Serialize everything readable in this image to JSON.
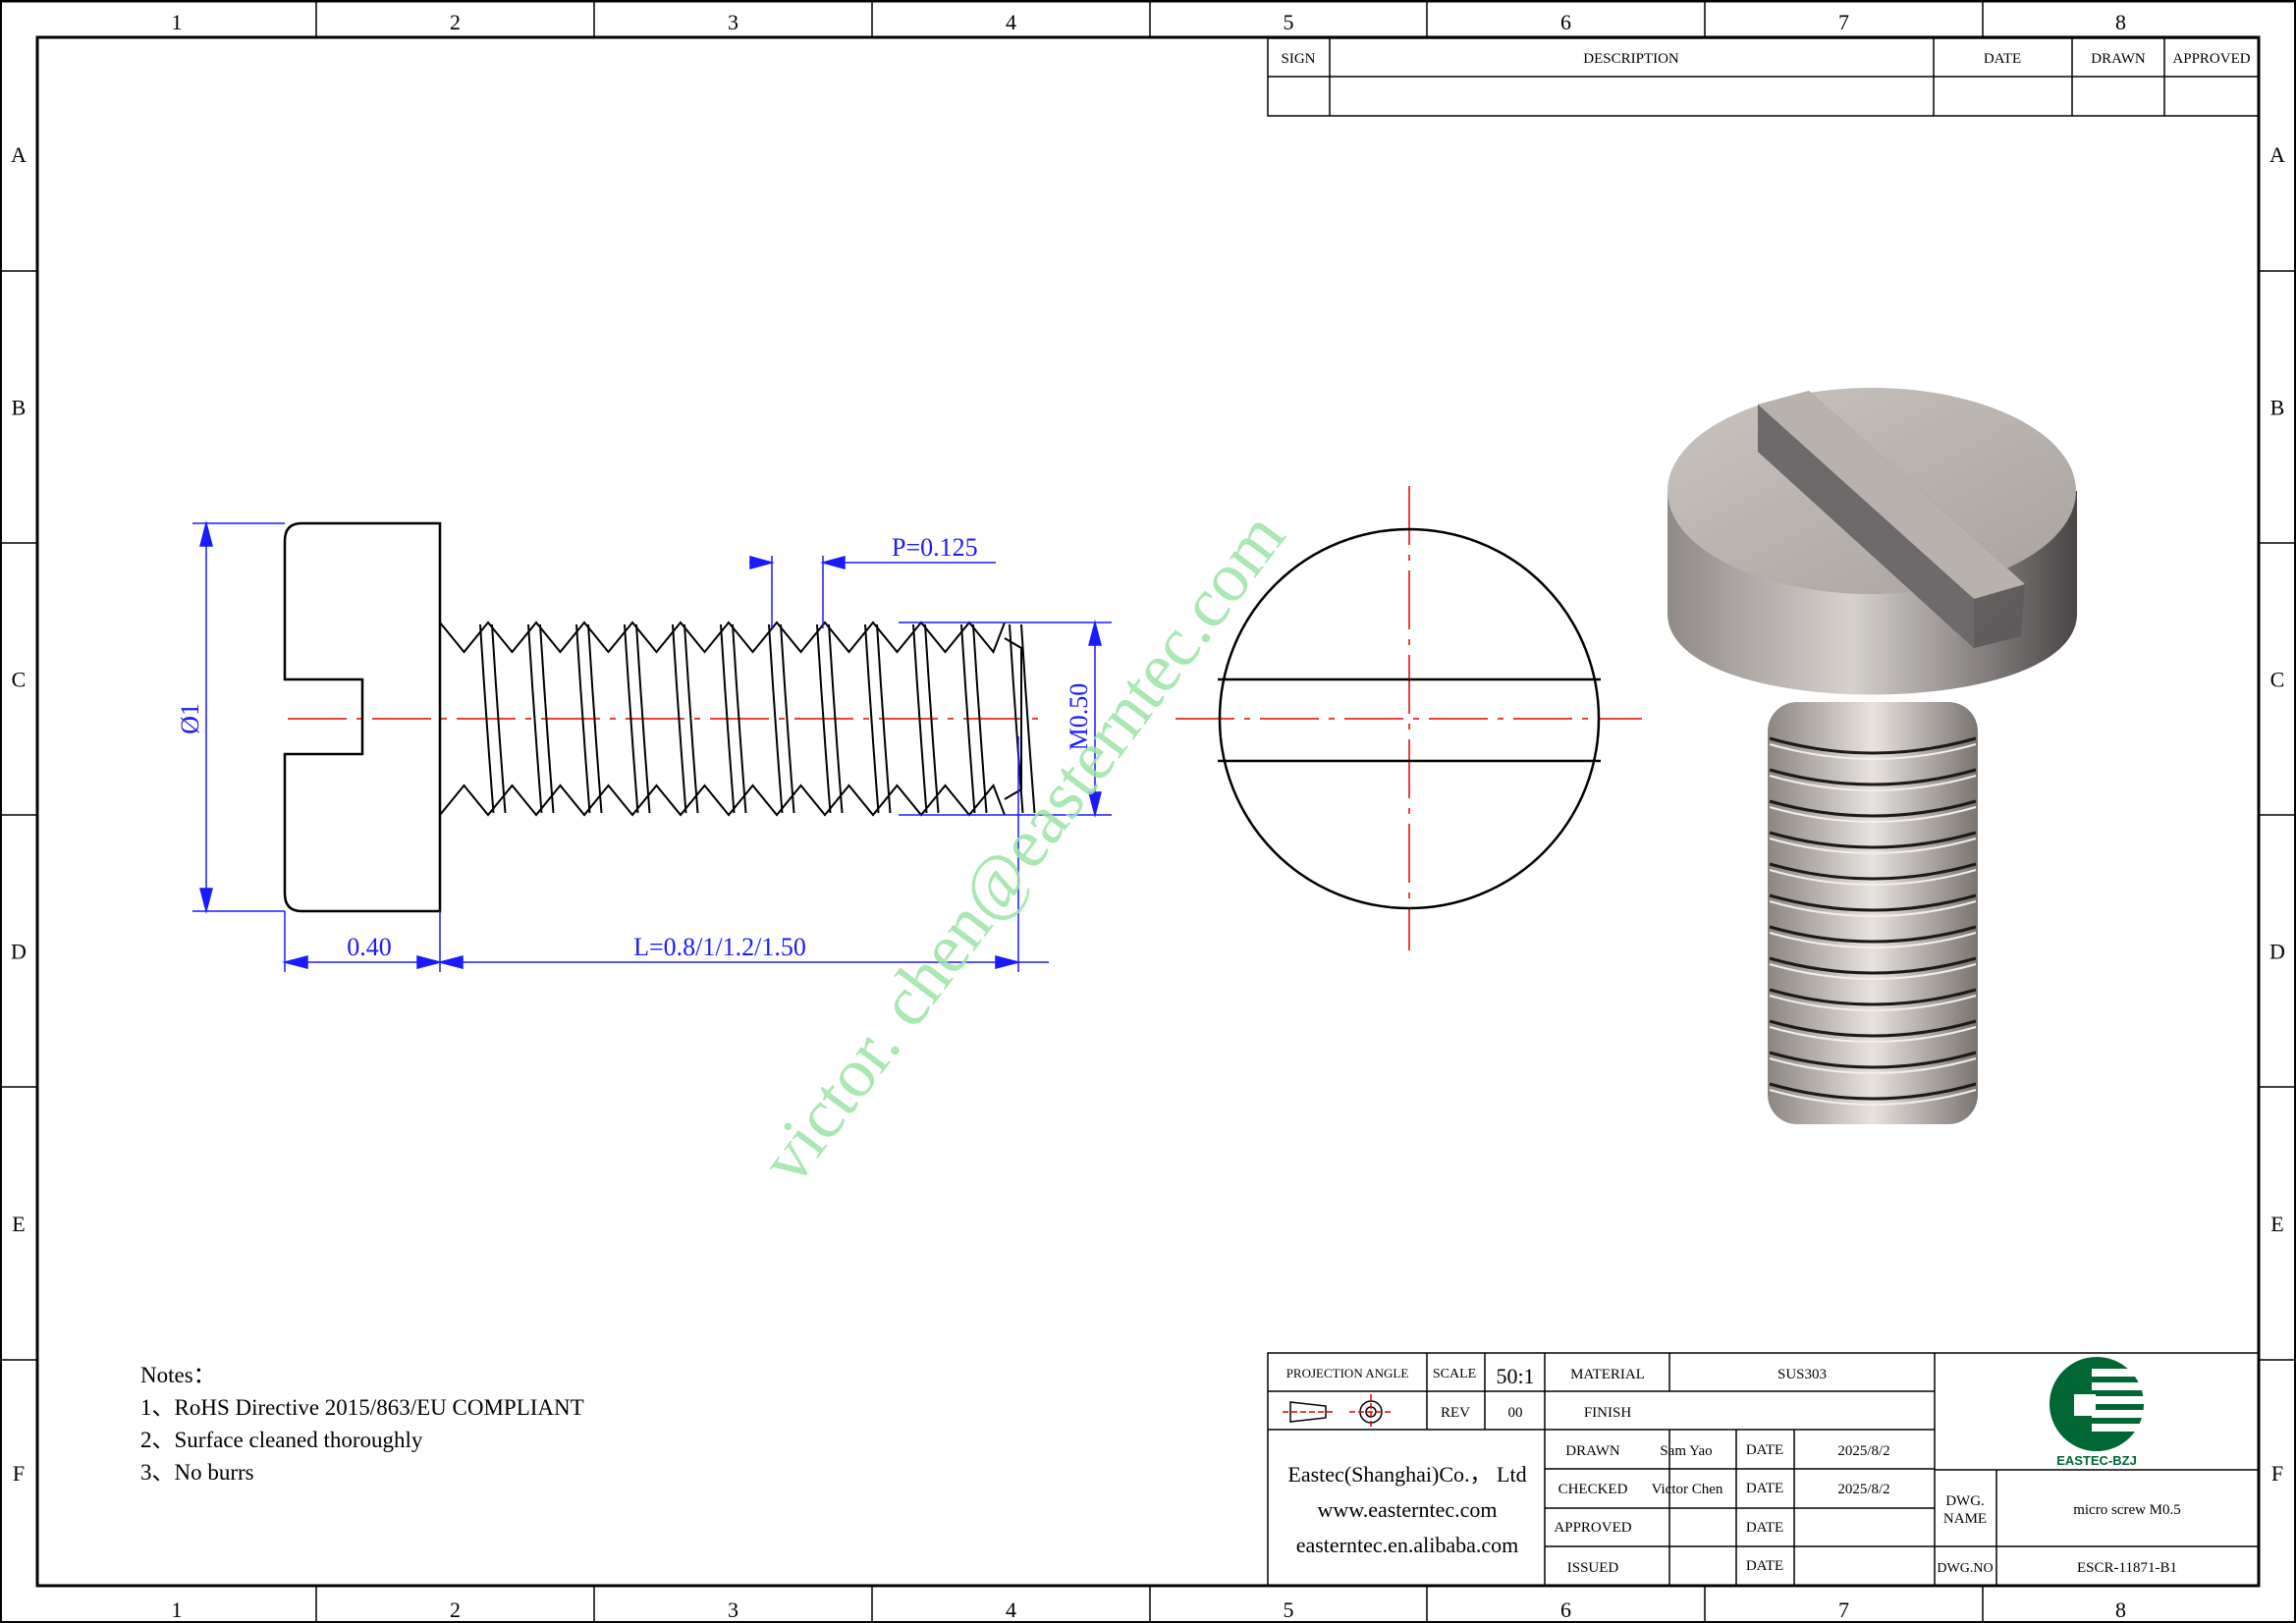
{
  "border": {
    "columns": [
      "1",
      "2",
      "3",
      "4",
      "5",
      "6",
      "7",
      "8"
    ],
    "rows": [
      "A",
      "B",
      "C",
      "D",
      "E",
      "F"
    ]
  },
  "revision_table": {
    "headers": {
      "sign": "SIGN",
      "description": "DESCRIPTION",
      "date": "DATE",
      "drawn": "DRAWN",
      "approved": "APPROVED"
    }
  },
  "dimensions": {
    "pitch": "P=0.125",
    "diameter": "Ø1",
    "thread": "M0.50",
    "head_length": "0.40",
    "length": "L=0.8/1/1.2/1.50"
  },
  "watermark": "victor. chen@easterntec.com",
  "notes": {
    "title": "Notes：",
    "items": [
      "1、RoHS Directive 2015/863/EU COMPLIANT",
      "2、Surface cleaned thoroughly",
      "3、No burrs"
    ]
  },
  "title_block": {
    "projection_angle_label": "PROJECTION ANGLE",
    "scale_label": "SCALE",
    "scale_value": "50:1",
    "material_label": "MATERIAL",
    "material_value": "SUS303",
    "rev_label": "REV",
    "rev_value": "00",
    "finish_label": "FINISH",
    "finish_value": "",
    "company": {
      "name": "Eastec(Shanghai)Co.， Ltd",
      "website": "www.easterntec.com",
      "store": "easterntec.en.alibaba.com"
    },
    "drawn_label": "DRAWN",
    "drawn_value": "Sam Yao",
    "checked_label": "CHECKED",
    "checked_value": "Victor Chen",
    "approved_label": "APPROVED",
    "approved_value": "",
    "issued_label": "ISSUED",
    "issued_value": "",
    "date_label": "DATE",
    "drawn_date": "2025/8/2",
    "checked_date": "2025/8/2",
    "logo_text": "EASTEC-BZJ",
    "dwg_name_label_1": "DWG.",
    "dwg_name_label_2": "NAME",
    "dwg_name_value": "micro screw M0.5",
    "dwg_no_label": "DWG.NO",
    "dwg_no_value": "ESCR-11871-B1"
  },
  "colors": {
    "dimension": "#1a1aff",
    "centerline": "#e60000",
    "watermark": "#9be3a6",
    "logo_green": "#006633"
  }
}
